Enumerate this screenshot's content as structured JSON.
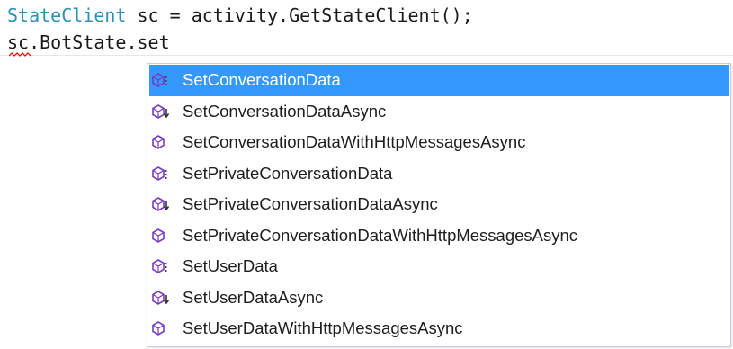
{
  "editor": {
    "line1": {
      "type_name": "StateClient",
      "rest": " sc = activity.GetStateClient();"
    },
    "line2": {
      "text": "sc.BotState.set"
    }
  },
  "completion": {
    "selected_index": 0,
    "items": [
      {
        "label": "SetConversationData",
        "icon": "method-overload-icon"
      },
      {
        "label": "SetConversationDataAsync",
        "icon": "extension-method-icon"
      },
      {
        "label": "SetConversationDataWithHttpMessagesAsync",
        "icon": "method-icon"
      },
      {
        "label": "SetPrivateConversationData",
        "icon": "method-overload-icon"
      },
      {
        "label": "SetPrivateConversationDataAsync",
        "icon": "extension-method-icon"
      },
      {
        "label": "SetPrivateConversationDataWithHttpMessagesAsync",
        "icon": "method-icon"
      },
      {
        "label": "SetUserData",
        "icon": "method-overload-icon"
      },
      {
        "label": "SetUserDataAsync",
        "icon": "extension-method-icon"
      },
      {
        "label": "SetUserDataWithHttpMessagesAsync",
        "icon": "method-icon"
      }
    ]
  },
  "colors": {
    "type_name": "#2b91af",
    "selection": "#3399ff",
    "method_icon": "#7a3bbf",
    "squiggle": "#e51400"
  }
}
